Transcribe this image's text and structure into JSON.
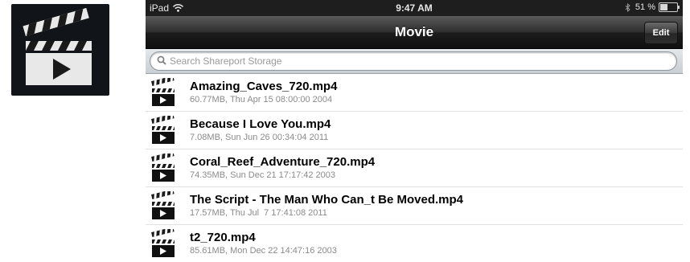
{
  "app_icon": {
    "icon": "movie-clapperboard-icon"
  },
  "status_bar": {
    "device": "iPad",
    "time": "9:47 AM",
    "battery_label": "51 %",
    "battery_level": 0.51
  },
  "nav_bar": {
    "title": "Movie",
    "edit_label": "Edit"
  },
  "search": {
    "placeholder": "Search Shareport Storage"
  },
  "files": [
    {
      "name": "Amazing_Caves_720.mp4",
      "meta": "60.77MB, Thu Apr 15 08:00:00 2004"
    },
    {
      "name": "Because I Love You.mp4",
      "meta": "7.08MB, Sun Jun 26 00:34:04 2011"
    },
    {
      "name": "Coral_Reef_Adventure_720.mp4",
      "meta": "74.35MB, Sun Dec 21 17:17:42 2003"
    },
    {
      "name": "The Script - The Man Who Can_t Be Moved.mp4",
      "meta": "17.57MB, Thu Jul  7 17:41:08 2011"
    },
    {
      "name": "t2_720.mp4",
      "meta": "85.61MB, Mon Dec 22 14:47:16 2003"
    }
  ]
}
